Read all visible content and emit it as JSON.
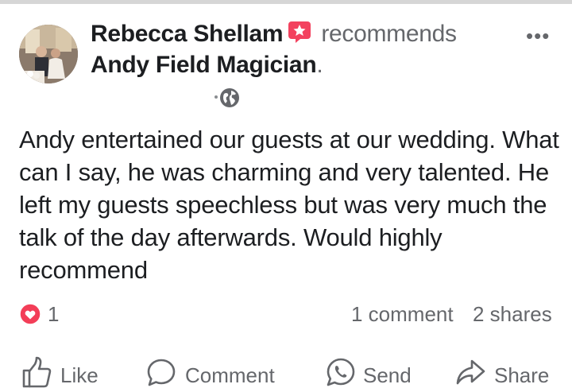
{
  "post": {
    "author": "Rebecca Shellam",
    "action_text": "recommends",
    "page_name": "Andy Field Magician",
    "page_name_suffix": ".",
    "more_label": "•••",
    "body": "Andy entertained our guests at our wedding. What can I say, he was charming and very talented. He left my guests speechless but was very much the talk of the day afterwards. Would highly recommend",
    "privacy_icon": "globe-icon",
    "recommend_icon": "recommend-badge-icon"
  },
  "stats": {
    "reaction_icon": "love-reaction-icon",
    "reaction_count": "1",
    "comments": "1 comment",
    "shares": "2 shares"
  },
  "actions": {
    "like": "Like",
    "comment": "Comment",
    "send": "Send",
    "share": "Share"
  },
  "colors": {
    "text_primary": "#1c1e21",
    "text_secondary": "#65676b",
    "recommend_badge": "#f3425f",
    "love_reaction": "#f33e58"
  }
}
